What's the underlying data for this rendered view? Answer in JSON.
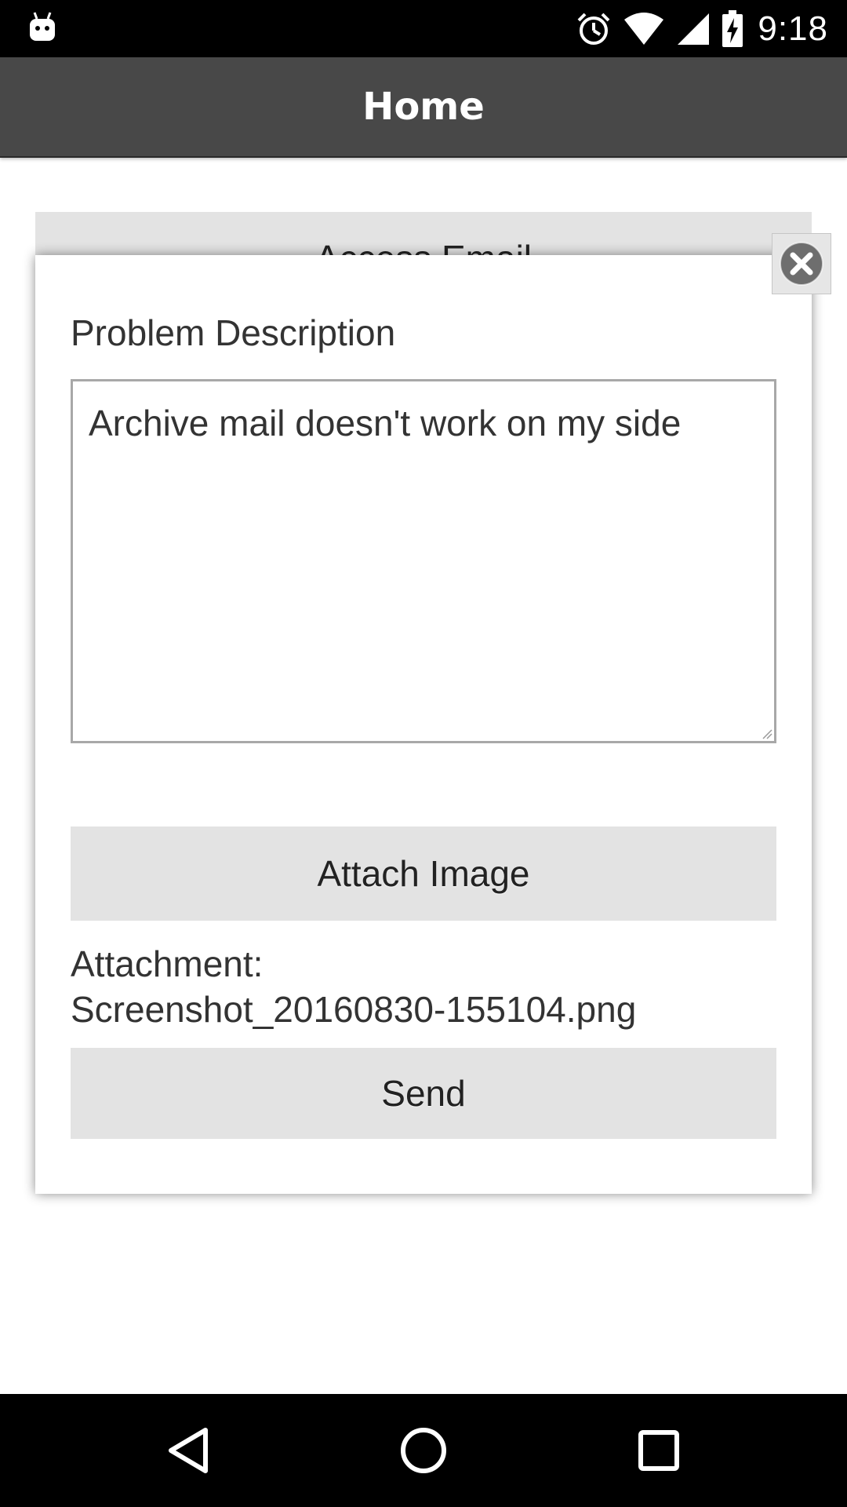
{
  "status_bar": {
    "time": "9:18",
    "icons": [
      "android-debug-icon",
      "alarm-icon",
      "wifi-icon",
      "signal-icon",
      "battery-charging-icon"
    ]
  },
  "app_bar": {
    "title": "Home"
  },
  "background": {
    "button_label": "Access Email"
  },
  "dialog": {
    "label": "Problem Description",
    "description_value": "Archive mail doesn't work on my side",
    "attach_button_label": "Attach Image",
    "attachment_prefix": "Attachment:",
    "attachment_filename": "Screenshot_20160830-155104.png",
    "send_button_label": "Send",
    "close_icon": "close-circle-icon"
  },
  "nav_bar": {
    "icons": [
      "back-icon",
      "home-icon",
      "recents-icon"
    ]
  },
  "colors": {
    "app_bar": "#484848",
    "button_bg": "#e3e3e3",
    "status_bar": "#000000"
  }
}
